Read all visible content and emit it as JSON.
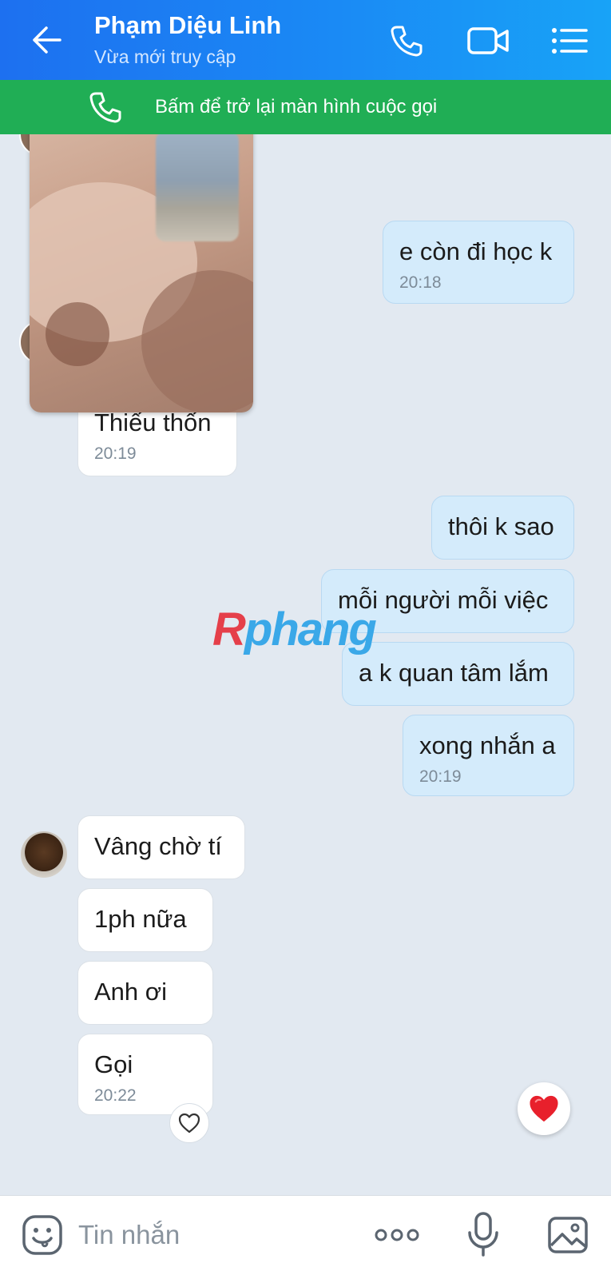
{
  "header": {
    "contact_name": "Phạm Diệu Linh",
    "status": "Vừa mới truy cập"
  },
  "call_banner": {
    "text": "Bấm để trở lại màn hình cuộc gọi"
  },
  "messages": [
    {
      "dir": "out",
      "text": "e còn đi học k",
      "time": "20:18"
    },
    {
      "dir": "in",
      "text": "Thiếu thốn",
      "time": "20:19"
    },
    {
      "dir": "out",
      "text": "thôi k sao"
    },
    {
      "dir": "out",
      "text": "mỗi người mỗi việc"
    },
    {
      "dir": "out",
      "text": "a k quan tâm lắm"
    },
    {
      "dir": "out",
      "text": "xong nhắn a",
      "time": "20:19"
    },
    {
      "dir": "in",
      "text": "Vâng chờ tí"
    },
    {
      "dir": "in",
      "text": "1ph nữa"
    },
    {
      "dir": "in",
      "text": "Anh ơi"
    },
    {
      "dir": "in",
      "text": "Gọi",
      "time": "20:22"
    }
  ],
  "watermark": {
    "part1": "R",
    "part2": "phang"
  },
  "input": {
    "placeholder": "Tin nhắn"
  },
  "colors": {
    "header_start": "#1d70f0",
    "header_end": "#18a3f7",
    "call_banner": "#20ae55",
    "outgoing_bubble": "#d4ebfb",
    "incoming_bubble": "#ffffff",
    "chat_background": "#e2e9f1",
    "heart": "#e8202c"
  },
  "icons": {
    "back": "arrow-left-icon",
    "call": "phone-icon",
    "video": "video-camera-icon",
    "menu": "list-menu-icon",
    "banner": "phone-icon",
    "emoji": "emoji-sticker-icon",
    "more": "more-dots-icon",
    "mic": "microphone-icon",
    "image": "image-gallery-icon",
    "reaction": "heart-outline-icon",
    "floating_reaction": "heart-filled-icon"
  }
}
